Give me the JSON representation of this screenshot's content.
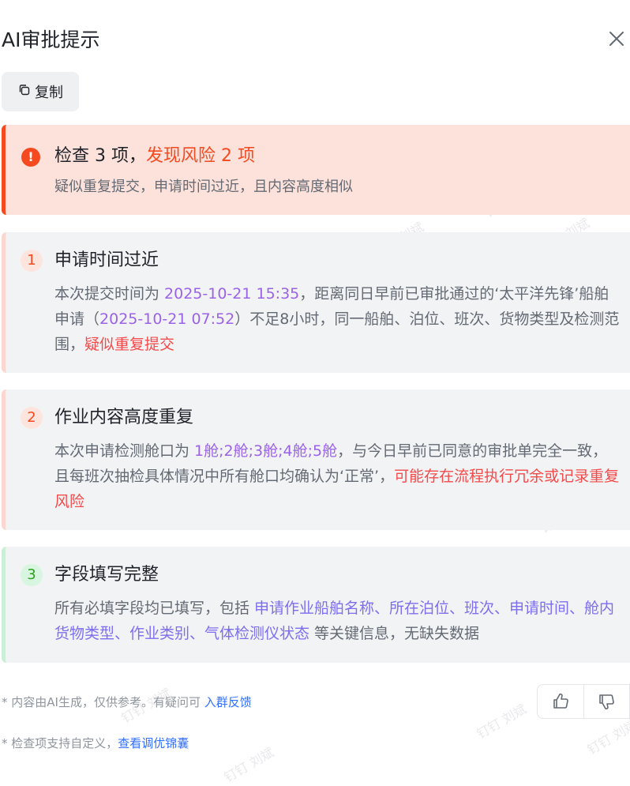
{
  "header": {
    "title": "AI审批提示",
    "close_icon": "close-icon"
  },
  "toolbar": {
    "copy_label": "复制",
    "copy_icon": "copy-icon"
  },
  "summary": {
    "prefix": "检查 3 项，",
    "risk_text": "发现风险 2 项",
    "detail": "疑似重复提交，申请时间过近，且内容高度相似",
    "alert_icon": "!",
    "color": "#f54a1f"
  },
  "checks": [
    {
      "number": "1",
      "title": "申请时间过近",
      "status": "risk",
      "body": [
        {
          "text": "本次提交时间为 ",
          "style": "plain"
        },
        {
          "text": "2025-10-21 15:35",
          "style": "purple"
        },
        {
          "text": "，距离同日早前已审批通过的‘太平洋先锋’船舶申请（",
          "style": "plain"
        },
        {
          "text": "2025-10-21 07:52",
          "style": "purple"
        },
        {
          "text": "）不足8小时，同一船舶、泊位、班次、货物类型及检测范围，",
          "style": "plain"
        },
        {
          "text": "疑似重复提交",
          "style": "red"
        }
      ]
    },
    {
      "number": "2",
      "title": "作业内容高度重复",
      "status": "risk",
      "body": [
        {
          "text": "本次申请检测舱口为 ",
          "style": "plain"
        },
        {
          "text": "1舱;2舱;3舱;4舱;5舱",
          "style": "purple"
        },
        {
          "text": "，与今日早前已同意的审批单完全一致，且每班次抽检具体情况中所有舱口均确认为‘正常’，",
          "style": "plain"
        },
        {
          "text": "可能存在流程执行冗余或记录重复风险",
          "style": "red"
        }
      ]
    },
    {
      "number": "3",
      "title": "字段填写完整",
      "status": "ok",
      "body": [
        {
          "text": "所有必填字段均已填写，包括 ",
          "style": "plain"
        },
        {
          "text": "申请作业船舶名称、所在泊位、班次、申请时间、舱内货物类型、作业类别、气体检测仪状态",
          "style": "grad"
        },
        {
          "text": " 等关键信息，无缺失数据",
          "style": "plain"
        }
      ]
    }
  ],
  "footer": {
    "note1": "* 内容由AI生成，仅供参考。有疑问可 ",
    "link1": "入群反馈",
    "note2": "* 检查项支持自定义，",
    "link2": "查看调优锦囊",
    "like_icon": "thumbs-up-icon",
    "dislike_icon": "thumbs-down-icon"
  },
  "watermark": "钉钉 刘斌",
  "colors": {
    "risk": "#f54a1f",
    "ok": "#2ea121",
    "link": "#3370ff",
    "highlight": "#9a63e7"
  }
}
